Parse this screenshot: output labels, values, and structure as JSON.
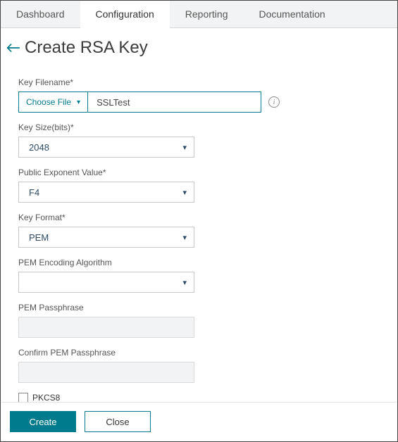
{
  "tabs": {
    "items": [
      "Dashboard",
      "Configuration",
      "Reporting",
      "Documentation"
    ],
    "active_index": 1
  },
  "header": {
    "title": "Create RSA Key"
  },
  "form": {
    "key_filename": {
      "label": "Key Filename*",
      "choose_file_label": "Choose File",
      "value": "SSLTest",
      "info_tooltip": "i"
    },
    "key_size": {
      "label": "Key Size(bits)*",
      "value": "2048"
    },
    "public_exponent": {
      "label": "Public Exponent Value*",
      "value": "F4"
    },
    "key_format": {
      "label": "Key Format*",
      "value": "PEM"
    },
    "pem_encoding": {
      "label": "PEM Encoding Algorithm",
      "value": ""
    },
    "pem_passphrase": {
      "label": "PEM Passphrase",
      "value": ""
    },
    "confirm_pem_passphrase": {
      "label": "Confirm PEM Passphrase",
      "value": ""
    },
    "pkcs8": {
      "label": "PKCS8",
      "checked": false
    }
  },
  "footer": {
    "create_label": "Create",
    "close_label": "Close"
  }
}
